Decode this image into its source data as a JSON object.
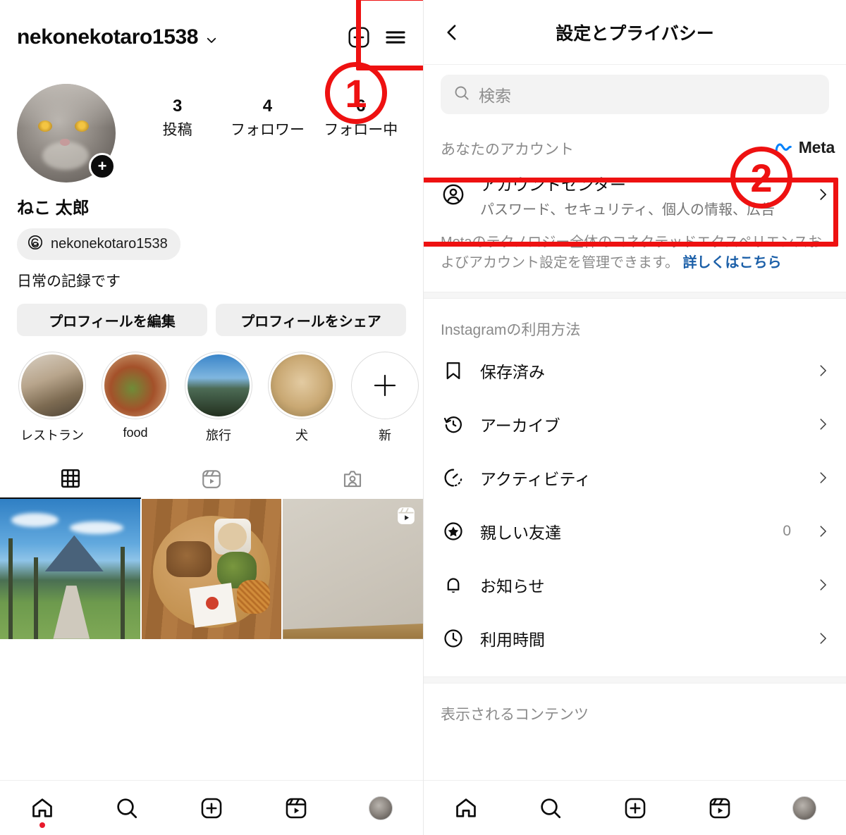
{
  "profile": {
    "username": "nekonekotaro1538",
    "dropdown_icon": "chevron-down-icon",
    "add_icon": "plus-square-icon",
    "menu_icon": "hamburger-menu-icon",
    "display_name": "ねこ 太郎",
    "threads_handle": "nekonekotaro1538",
    "bio": "日常の記録です",
    "stats": [
      {
        "num": "3",
        "label": "投稿"
      },
      {
        "num": "4",
        "label": "フォロワー"
      },
      {
        "num": "6",
        "label": "フォロー中"
      }
    ],
    "buttons": {
      "edit": "プロフィールを編集",
      "share": "プロフィールをシェア"
    },
    "highlights": [
      {
        "label": "レストラン",
        "kind": "restaurant"
      },
      {
        "label": "food",
        "kind": "food"
      },
      {
        "label": "旅行",
        "kind": "travel"
      },
      {
        "label": "犬",
        "kind": "dog"
      },
      {
        "label": "新",
        "kind": "new"
      }
    ],
    "tabs": [
      {
        "name": "grid-tab",
        "icon": "grid-icon",
        "active": true
      },
      {
        "name": "reels-tab",
        "icon": "reels-icon",
        "active": false
      },
      {
        "name": "tagged-tab",
        "icon": "tagged-icon",
        "active": false
      }
    ],
    "posts": [
      {
        "kind": "landscape",
        "is_reel": false
      },
      {
        "kind": "food",
        "is_reel": false
      },
      {
        "kind": "wall",
        "is_reel": true
      }
    ]
  },
  "settings": {
    "back_icon": "back-chevron-icon",
    "title": "設定とプライバシー",
    "search": {
      "icon": "search-icon",
      "placeholder": "検索",
      "value": ""
    },
    "sections": [
      {
        "title": "あなたのアカウント",
        "badge": "Meta",
        "rows": [
          {
            "icon": "account-circle-icon",
            "title": "アカウントセンター",
            "subtitle": "パスワード、セキュリティ、個人の情報、広告",
            "count": "",
            "chevron": "chevron-right-icon",
            "highlighted": true
          }
        ],
        "helper_text": "Metaのテクノロジー全体のコネクテッドエクスペリエンスおよびアカウント設定を管理できます。",
        "helper_link": "詳しくはこちら"
      },
      {
        "title": "Instagramの利用方法",
        "badge": "",
        "rows": [
          {
            "icon": "bookmark-icon",
            "title": "保存済み",
            "subtitle": "",
            "count": "",
            "chevron": "chevron-right-icon",
            "highlighted": false
          },
          {
            "icon": "archive-clock-icon",
            "title": "アーカイブ",
            "subtitle": "",
            "count": "",
            "chevron": "chevron-right-icon",
            "highlighted": false
          },
          {
            "icon": "activity-icon",
            "title": "アクティビティ",
            "subtitle": "",
            "count": "",
            "chevron": "chevron-right-icon",
            "highlighted": false
          },
          {
            "icon": "close-friends-star-icon",
            "title": "親しい友達",
            "subtitle": "",
            "count": "0",
            "chevron": "chevron-right-icon",
            "highlighted": false
          },
          {
            "icon": "bell-icon",
            "title": "お知らせ",
            "subtitle": "",
            "count": "",
            "chevron": "chevron-right-icon",
            "highlighted": false
          },
          {
            "icon": "clock-icon",
            "title": "利用時間",
            "subtitle": "",
            "count": "",
            "chevron": "chevron-right-icon",
            "highlighted": false
          }
        ],
        "helper_text": "",
        "helper_link": ""
      },
      {
        "title": "表示されるコンテンツ",
        "badge": "",
        "rows": [],
        "helper_text": "",
        "helper_link": ""
      }
    ]
  },
  "bottom_nav": [
    {
      "name": "home",
      "icon": "home-icon",
      "badge_dot": true
    },
    {
      "name": "search",
      "icon": "search-icon",
      "badge_dot": false
    },
    {
      "name": "create",
      "icon": "plus-square-icon",
      "badge_dot": false
    },
    {
      "name": "reels",
      "icon": "reels-icon",
      "badge_dot": false
    },
    {
      "name": "profile",
      "icon": "avatar-icon",
      "badge_dot": false
    }
  ],
  "annotations": [
    {
      "label": "1",
      "kind": "circle-number"
    },
    {
      "label": "2",
      "kind": "circle-number"
    }
  ],
  "colors": {
    "annotation_red": "#ee1111",
    "notification_red": "#e8192c",
    "link_blue": "#1b5fa8",
    "meta_blue": "#0081fb",
    "text_primary": "#0c0c0c",
    "text_secondary": "#8a8a8a",
    "chip_gray": "#efefef"
  }
}
